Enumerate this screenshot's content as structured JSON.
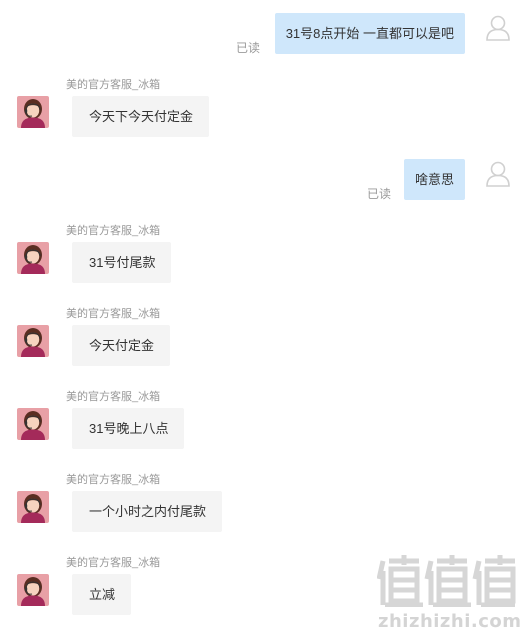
{
  "messages": [
    {
      "side": "right",
      "text": "31号8点开始 一直都可以是吧",
      "status": "已读"
    },
    {
      "side": "left",
      "sender": "美的官方客服_冰箱",
      "text": "今天下今天付定金"
    },
    {
      "side": "right",
      "text": "啥意思",
      "status": "已读"
    },
    {
      "side": "left",
      "sender": "美的官方客服_冰箱",
      "text": "31号付尾款"
    },
    {
      "side": "left",
      "sender": "美的官方客服_冰箱",
      "text": "今天付定金"
    },
    {
      "side": "left",
      "sender": "美的官方客服_冰箱",
      "text": "31号晚上八点"
    },
    {
      "side": "left",
      "sender": "美的官方客服_冰箱",
      "text": "一个小时之内付尾款"
    },
    {
      "side": "left",
      "sender": "美的官方客服_冰箱",
      "text": "立减"
    }
  ],
  "watermark": {
    "logo": "值值值",
    "text": "zhizhizhi.com"
  },
  "colors": {
    "user_bubble": "#cfe7fb",
    "agent_bubble": "#f4f4f4",
    "meta_text": "#999999"
  },
  "icons": {
    "user_avatar": "user-silhouette-icon",
    "agent_avatar": "agent-headset-avatar"
  }
}
